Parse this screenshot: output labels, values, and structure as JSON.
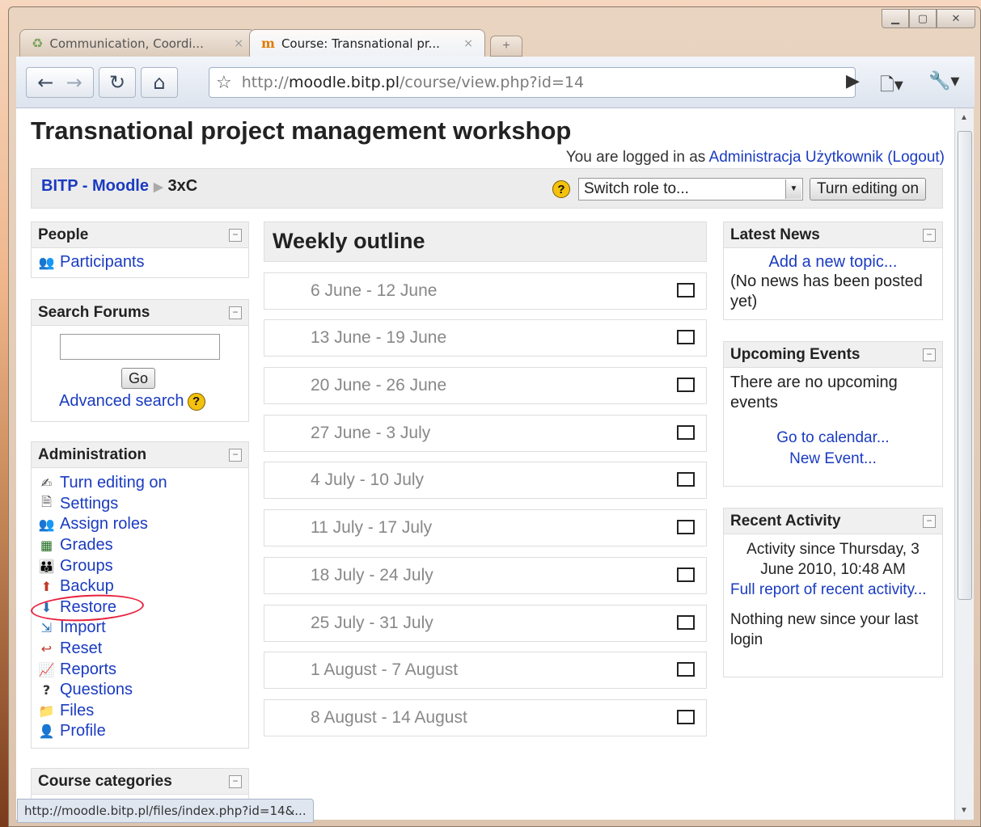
{
  "browser": {
    "tabs": [
      {
        "title": "Communication, Coordi...",
        "close": "×"
      },
      {
        "title": "Course: Transnational pr...",
        "close": "×"
      }
    ],
    "new_tab": "+",
    "url_scheme": "http://",
    "url_host": "moodle.bitp.pl",
    "url_path": "/course/view.php?id=14",
    "status_url": "http://moodle.bitp.pl/files/index.php?id=14&..."
  },
  "page": {
    "title": "Transnational project management workshop",
    "login": {
      "prefix": "You are logged in as ",
      "user": "Administracja Użytkownik",
      "logout": "(Logout)"
    },
    "breadcrumb": {
      "home": "BITP - Moodle",
      "current": "3xC"
    },
    "switch_role": "Switch role to...",
    "turn_editing": "Turn editing on"
  },
  "left": {
    "people": {
      "title": "People",
      "participants": "Participants"
    },
    "search": {
      "title": "Search Forums",
      "go": "Go",
      "advanced": "Advanced search"
    },
    "admin": {
      "title": "Administration",
      "items": [
        {
          "label": "Turn editing on",
          "icon": "✍"
        },
        {
          "label": "Settings",
          "icon": "🗎"
        },
        {
          "label": "Assign roles",
          "icon": "👥"
        },
        {
          "label": "Grades",
          "icon": "▦"
        },
        {
          "label": "Groups",
          "icon": "👪"
        },
        {
          "label": "Backup",
          "icon": "⬆"
        },
        {
          "label": "Restore",
          "icon": "⬇"
        },
        {
          "label": "Import",
          "icon": "⇲"
        },
        {
          "label": "Reset",
          "icon": "↩"
        },
        {
          "label": "Reports",
          "icon": "📈"
        },
        {
          "label": "Questions",
          "icon": "?"
        },
        {
          "label": "Files",
          "icon": "📁"
        },
        {
          "label": "Profile",
          "icon": "👤"
        }
      ]
    },
    "categories": {
      "title": "Course categories"
    }
  },
  "center": {
    "heading": "Weekly outline",
    "weeks": [
      "6 June - 12 June",
      "13 June - 19 June",
      "20 June - 26 June",
      "27 June - 3 July",
      "4 July - 10 July",
      "11 July - 17 July",
      "18 July - 24 July",
      "25 July - 31 July",
      "1 August - 7 August",
      "8 August - 14 August"
    ]
  },
  "right": {
    "news": {
      "title": "Latest News",
      "add": "Add a new topic...",
      "empty": "(No news has been posted yet)"
    },
    "events": {
      "title": "Upcoming Events",
      "empty": "There are no upcoming events",
      "calendar": "Go to calendar...",
      "new_event": "New Event..."
    },
    "activity": {
      "title": "Recent Activity",
      "since": "Activity since Thursday, 3 June 2010, 10:48 AM",
      "full": "Full report of recent activity...",
      "nothing": "Nothing new since your last login"
    }
  },
  "colors": {
    "link": "#1a3bc0",
    "highlight": "#e8213d"
  }
}
